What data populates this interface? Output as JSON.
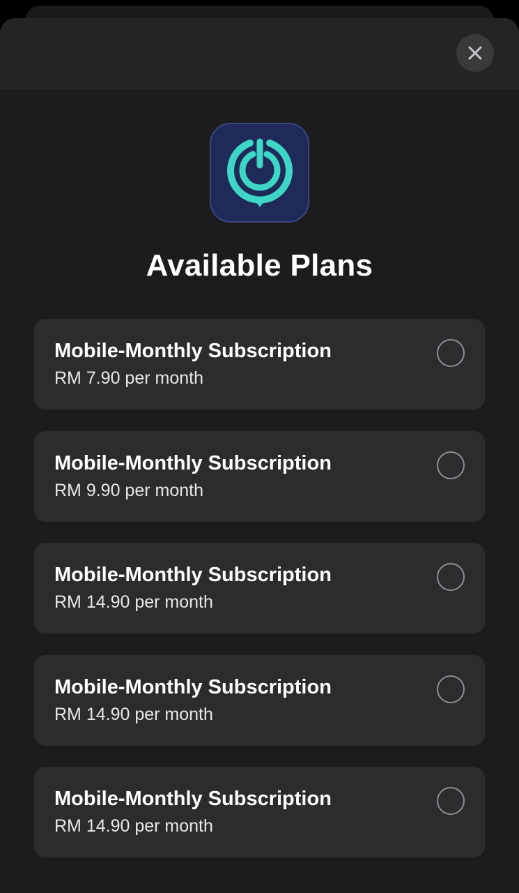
{
  "header": {
    "close_icon": "close-icon"
  },
  "app": {
    "icon": "app-logo-icon",
    "colors": {
      "background": "#1f2a5a",
      "accent": "#3ed6c6"
    }
  },
  "title": "Available Plans",
  "plans": [
    {
      "name": "Mobile-Monthly Subscription",
      "price": "RM 7.90 per month",
      "selected": false
    },
    {
      "name": "Mobile-Monthly Subscription",
      "price": "RM 9.90 per month",
      "selected": false
    },
    {
      "name": "Mobile-Monthly Subscription",
      "price": "RM 14.90 per month",
      "selected": false
    },
    {
      "name": "Mobile-Monthly Subscription",
      "price": "RM 14.90 per month",
      "selected": false
    },
    {
      "name": "Mobile-Monthly Subscription",
      "price": "RM 14.90 per month",
      "selected": false
    }
  ],
  "colors": {
    "sheet_background": "#1c1c1e",
    "card_background": "#2c2c2e",
    "radio_border": "#8e8e93"
  }
}
